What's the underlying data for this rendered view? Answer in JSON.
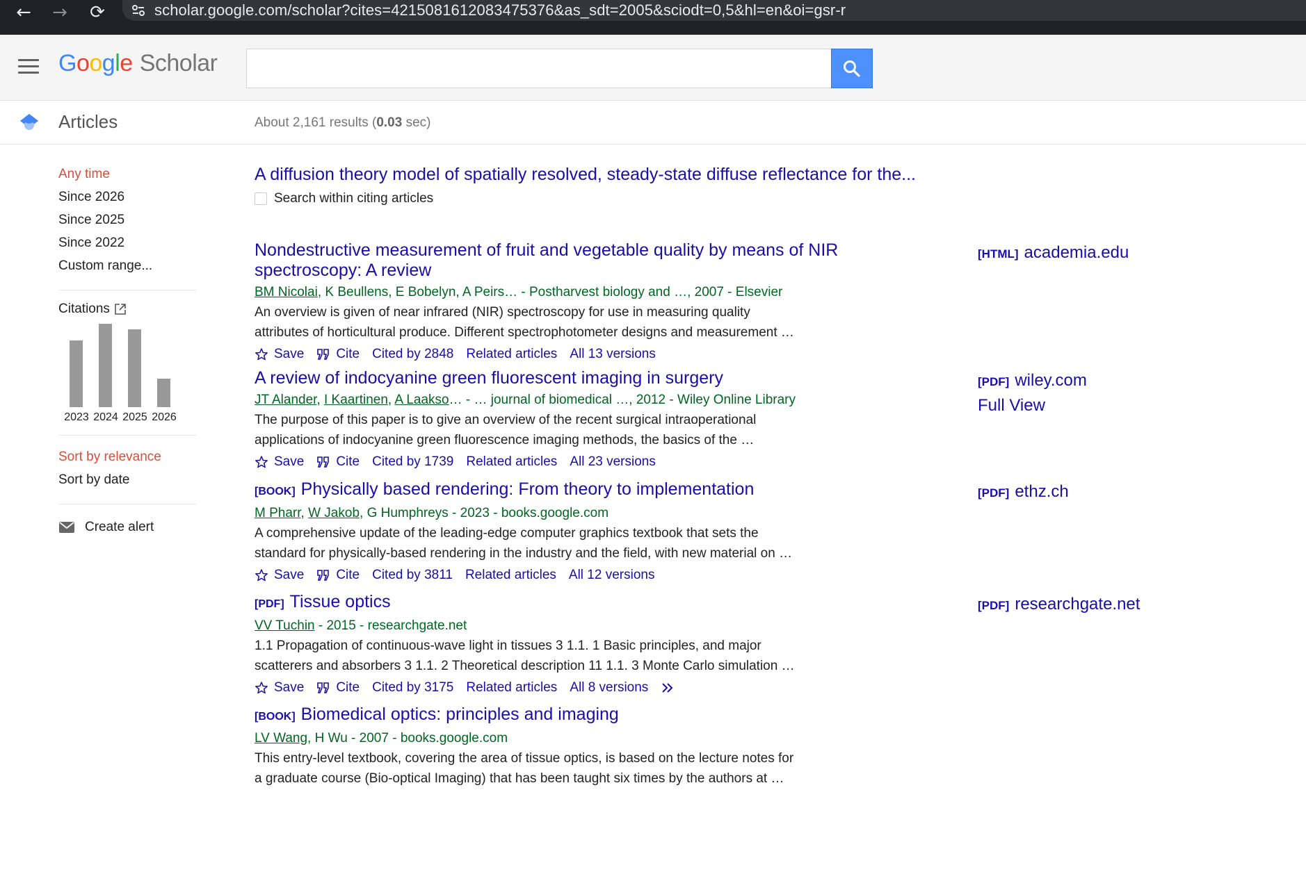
{
  "browser": {
    "back_label": "←",
    "forward_label": "→",
    "reload_label": "⟳",
    "url": "scholar.google.com/scholar?cites=4215081612083475376&as_sdt=2005&sciodt=0,5&hl=en&oi=gsr-r"
  },
  "header": {
    "logo_google": [
      "G",
      "o",
      "o",
      "g",
      "l",
      "e"
    ],
    "logo_scholar": "Scholar",
    "search_value": "",
    "search_placeholder": ""
  },
  "articles_bar": {
    "label": "Articles",
    "results_prefix": "About 2,161 results (",
    "results_time": "0.03",
    "results_suffix": " sec)"
  },
  "sidebar": {
    "time_filters": [
      "Any time",
      "Since 2026",
      "Since 2025",
      "Since 2022",
      "Custom range..."
    ],
    "active_time_index": 0,
    "citations_label": "Citations",
    "chart_data": {
      "type": "bar",
      "categories": [
        "2023",
        "2024",
        "2025",
        "2026"
      ],
      "values": [
        80,
        100,
        93,
        34
      ],
      "title": "",
      "xlabel": "",
      "ylabel": ""
    },
    "sort_options": [
      "Sort by relevance",
      "Sort by date"
    ],
    "active_sort_index": 0,
    "create_alert": "Create alert"
  },
  "cited_article": {
    "title": "A diffusion theory model of spatially resolved, steady-state diffuse reflectance for the...",
    "search_within": "Search within citing articles"
  },
  "results": [
    {
      "type": "",
      "title_lines": [
        "Nondestructive measurement of fruit and vegetable quality by means of NIR",
        "spectroscopy: A review"
      ],
      "authors": [
        {
          "text": "BM Nicolai",
          "link": true
        },
        {
          "text": ", ",
          "link": false
        },
        {
          "text": "K Beullens",
          "link": false
        },
        {
          "text": ", ",
          "link": false
        },
        {
          "text": "E Bobelyn",
          "link": false
        },
        {
          "text": ", ",
          "link": false
        },
        {
          "text": "A Peirs",
          "link": false
        }
      ],
      "source": "… - Postharvest biology and …, 2007 - Elsevier",
      "snippet_lines": [
        "An overview is given of near infrared (NIR) spectroscopy for use in measuring quality",
        "attributes of horticultural produce. Different spectrophotometer designs and measurement …"
      ],
      "save": "Save",
      "cite": "Cite",
      "cited_by": "Cited by 2848",
      "related": "Related articles",
      "versions": "All 13 versions",
      "side_tag": "[HTML]",
      "side_label": "academia.edu",
      "side_extra": ""
    },
    {
      "type": "",
      "title_lines": [
        "A review of indocyanine green fluorescent imaging in surgery"
      ],
      "authors": [
        {
          "text": "JT Alander",
          "link": true
        },
        {
          "text": ", ",
          "link": false
        },
        {
          "text": "I Kaartinen",
          "link": true
        },
        {
          "text": ", ",
          "link": false
        },
        {
          "text": "A Laakso",
          "link": true
        }
      ],
      "source": "… - … journal of biomedical …, 2012 - Wiley Online Library",
      "snippet_lines": [
        "The purpose of this paper is to give an overview of the recent surgical intraoperational",
        "applications of indocyanine green fluorescence imaging methods, the basics of the …"
      ],
      "save": "Save",
      "cite": "Cite",
      "cited_by": "Cited by 1739",
      "related": "Related articles",
      "versions": "All 23 versions",
      "side_tag": "[PDF]",
      "side_label": "wiley.com",
      "side_extra": "Full View"
    },
    {
      "type": "[BOOK]",
      "title_lines": [
        "Physically based rendering: From theory to implementation"
      ],
      "authors": [
        {
          "text": "M Pharr",
          "link": true
        },
        {
          "text": ", ",
          "link": false
        },
        {
          "text": "W Jakob",
          "link": true
        },
        {
          "text": ", ",
          "link": false
        },
        {
          "text": "G Humphreys",
          "link": false
        }
      ],
      "source": " - 2023 - books.google.com",
      "snippet_lines": [
        "A comprehensive update of the leading-edge computer graphics textbook that sets the",
        "standard for physically-based rendering in the industry and the field, with new material on …"
      ],
      "save": "Save",
      "cite": "Cite",
      "cited_by": "Cited by 3811",
      "related": "Related articles",
      "versions": "All 12 versions",
      "side_tag": "[PDF]",
      "side_label": "ethz.ch",
      "side_extra": ""
    },
    {
      "type": "[PDF]",
      "title_lines": [
        "Tissue optics"
      ],
      "authors": [
        {
          "text": "VV Tuchin",
          "link": true
        }
      ],
      "source": " - 2015 - researchgate.net",
      "snippet_lines": [
        "1.1 Propagation of continuous-wave light in tissues 3 1.1. 1 Basic principles, and major",
        "scatterers and absorbers 3 1.1. 2 Theoretical description 11 1.1. 3 Monte Carlo simulation …"
      ],
      "save": "Save",
      "cite": "Cite",
      "cited_by": "Cited by 3175",
      "related": "Related articles",
      "versions": "All 8 versions",
      "side_tag": "[PDF]",
      "side_label": "researchgate.net",
      "side_extra": ""
    },
    {
      "type": "[BOOK]",
      "title_lines": [
        "Biomedical optics: principles and imaging"
      ],
      "authors": [
        {
          "text": "LV Wang",
          "link": true
        },
        {
          "text": ", ",
          "link": false
        },
        {
          "text": "H Wu",
          "link": false
        }
      ],
      "source": " - 2007 - books.google.com",
      "snippet_lines": [
        "This entry-level textbook, covering the area of tissue optics, is based on the lecture notes for",
        "a graduate course (Bio-optical Imaging) that has been taught six times by the authors at …"
      ],
      "save": "",
      "cite": "",
      "cited_by": "",
      "related": "",
      "versions": "",
      "side_tag": "",
      "side_label": "",
      "side_extra": ""
    }
  ],
  "colors": {
    "link": "#1a0dab",
    "author_green": "#006621",
    "active_red": "#dd4b39",
    "search_blue": "#4d90fe",
    "bar_gray": "#999999"
  }
}
